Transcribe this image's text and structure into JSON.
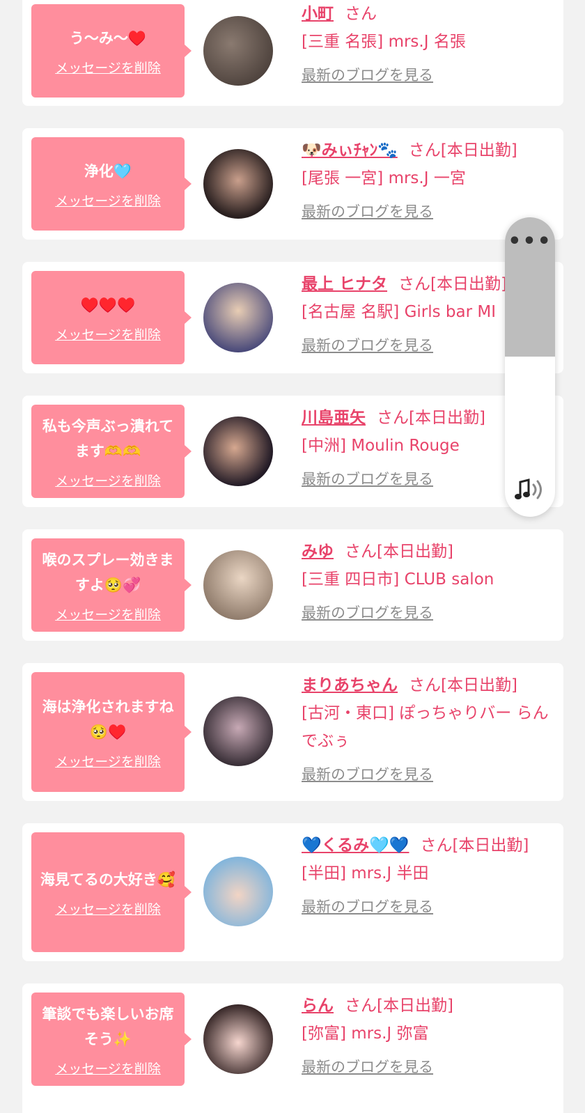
{
  "ui": {
    "delete_label": "メッセージを削除",
    "blog_label": "最新のブログを見る",
    "more_label": "•••"
  },
  "colors": {
    "bubble": "#ff8e9d",
    "accent": "#e8436a",
    "link_gray": "#8c8c8c"
  },
  "items": [
    {
      "message": "う〜み〜♥️",
      "name": "小町",
      "suffix": "さん",
      "shop": "[三重 名張] mrs.J 名張"
    },
    {
      "message": "浄化🩵",
      "name": "🐶みぃﾁｬﾝ🐾",
      "suffix": "さん[本日出勤]",
      "shop": "[尾張 一宮] mrs.J 一宮"
    },
    {
      "message": "♥️♥️♥️",
      "name": "最上 ヒナタ",
      "suffix": "さん[本日出勤]",
      "shop": "[名古屋 名駅] Girls bar MI"
    },
    {
      "message": "私も今声ぶっ潰れてます🫶🫶",
      "name": "川島亜矢",
      "suffix": "さん[本日出勤]",
      "shop": "[中洲] Moulin Rouge"
    },
    {
      "message": "喉のスプレー効きますよ🥺💞",
      "name": "みゆ",
      "suffix": "さん[本日出勤]",
      "shop": "[三重 四日市] CLUB salon"
    },
    {
      "message": "海は浄化されますね🥺♥️",
      "name": "まりあちゃん",
      "suffix": "さん[本日出勤]",
      "shop": "[古河・東口] ぽっちゃりバー らんでぶぅ"
    },
    {
      "message": "海見てるの大好き🥰",
      "name": "💙くるみ🩵💙",
      "suffix": "さん[本日出勤]",
      "shop": "[半田] mrs.J 半田"
    },
    {
      "message": "筆談でも楽しいお席そう✨",
      "name": "らん",
      "suffix": "さん[本日出勤]",
      "shop": "[弥富] mrs.J 弥富"
    }
  ]
}
